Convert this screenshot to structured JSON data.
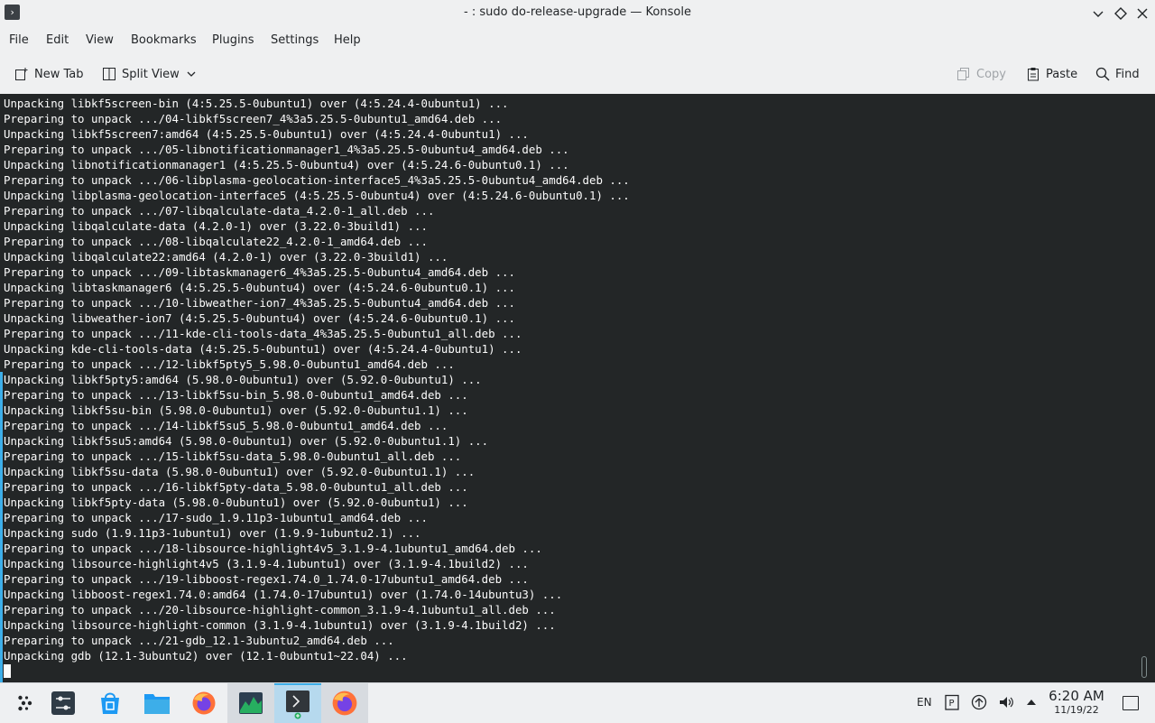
{
  "window": {
    "title": "- : sudo do-release-upgrade — Konsole"
  },
  "menu": [
    "File",
    "Edit",
    "View",
    "Bookmarks",
    "Plugins",
    "Settings",
    "Help"
  ],
  "toolbar": {
    "new_tab": "New Tab",
    "split_view": "Split View",
    "copy": "Copy",
    "paste": "Paste",
    "find": "Find"
  },
  "terminal": {
    "lines": [
      "Unpacking libkf5screen-bin (4:5.25.5-0ubuntu1) over (4:5.24.4-0ubuntu1) ...",
      "Preparing to unpack .../04-libkf5screen7_4%3a5.25.5-0ubuntu1_amd64.deb ...",
      "Unpacking libkf5screen7:amd64 (4:5.25.5-0ubuntu1) over (4:5.24.4-0ubuntu1) ...",
      "Preparing to unpack .../05-libnotificationmanager1_4%3a5.25.5-0ubuntu4_amd64.deb ...",
      "Unpacking libnotificationmanager1 (4:5.25.5-0ubuntu4) over (4:5.24.6-0ubuntu0.1) ...",
      "Preparing to unpack .../06-libplasma-geolocation-interface5_4%3a5.25.5-0ubuntu4_amd64.deb ...",
      "Unpacking libplasma-geolocation-interface5 (4:5.25.5-0ubuntu4) over (4:5.24.6-0ubuntu0.1) ...",
      "Preparing to unpack .../07-libqalculate-data_4.2.0-1_all.deb ...",
      "Unpacking libqalculate-data (4.2.0-1) over (3.22.0-3build1) ...",
      "Preparing to unpack .../08-libqalculate22_4.2.0-1_amd64.deb ...",
      "Unpacking libqalculate22:amd64 (4.2.0-1) over (3.22.0-3build1) ...",
      "Preparing to unpack .../09-libtaskmanager6_4%3a5.25.5-0ubuntu4_amd64.deb ...",
      "Unpacking libtaskmanager6 (4:5.25.5-0ubuntu4) over (4:5.24.6-0ubuntu0.1) ...",
      "Preparing to unpack .../10-libweather-ion7_4%3a5.25.5-0ubuntu4_amd64.deb ...",
      "Unpacking libweather-ion7 (4:5.25.5-0ubuntu4) over (4:5.24.6-0ubuntu0.1) ...",
      "Preparing to unpack .../11-kde-cli-tools-data_4%3a5.25.5-0ubuntu1_all.deb ...",
      "Unpacking kde-cli-tools-data (4:5.25.5-0ubuntu1) over (4:5.24.4-0ubuntu1) ...",
      "Preparing to unpack .../12-libkf5pty5_5.98.0-0ubuntu1_amd64.deb ...",
      "Unpacking libkf5pty5:amd64 (5.98.0-0ubuntu1) over (5.92.0-0ubuntu1) ...",
      "Preparing to unpack .../13-libkf5su-bin_5.98.0-0ubuntu1_amd64.deb ...",
      "Unpacking libkf5su-bin (5.98.0-0ubuntu1) over (5.92.0-0ubuntu1.1) ...",
      "Preparing to unpack .../14-libkf5su5_5.98.0-0ubuntu1_amd64.deb ...",
      "Unpacking libkf5su5:amd64 (5.98.0-0ubuntu1) over (5.92.0-0ubuntu1.1) ...",
      "Preparing to unpack .../15-libkf5su-data_5.98.0-0ubuntu1_all.deb ...",
      "Unpacking libkf5su-data (5.98.0-0ubuntu1) over (5.92.0-0ubuntu1.1) ...",
      "Preparing to unpack .../16-libkf5pty-data_5.98.0-0ubuntu1_all.deb ...",
      "Unpacking libkf5pty-data (5.98.0-0ubuntu1) over (5.92.0-0ubuntu1) ...",
      "Preparing to unpack .../17-sudo_1.9.11p3-1ubuntu1_amd64.deb ...",
      "Unpacking sudo (1.9.11p3-1ubuntu1) over (1.9.9-1ubuntu2.1) ...",
      "Preparing to unpack .../18-libsource-highlight4v5_3.1.9-4.1ubuntu1_amd64.deb ...",
      "Unpacking libsource-highlight4v5 (3.1.9-4.1ubuntu1) over (3.1.9-4.1build2) ...",
      "Preparing to unpack .../19-libboost-regex1.74.0_1.74.0-17ubuntu1_amd64.deb ...",
      "Unpacking libboost-regex1.74.0:amd64 (1.74.0-17ubuntu1) over (1.74.0-14ubuntu3) ...",
      "Preparing to unpack .../20-libsource-highlight-common_3.1.9-4.1ubuntu1_all.deb ...",
      "Unpacking libsource-highlight-common (3.1.9-4.1ubuntu1) over (3.1.9-4.1build2) ...",
      "Preparing to unpack .../21-gdb_12.1-3ubuntu2_amd64.deb ...",
      "Unpacking gdb (12.1-3ubuntu2) over (12.1-0ubuntu1~22.04) ..."
    ]
  },
  "taskbar": {
    "tasks": [
      {
        "icon": "app-launcher-icon"
      },
      {
        "icon": "system-settings-icon"
      },
      {
        "icon": "discover-icon"
      },
      {
        "icon": "file-manager-icon"
      },
      {
        "icon": "firefox-icon"
      },
      {
        "icon": "system-monitor-icon"
      },
      {
        "icon": "konsole-icon"
      },
      {
        "icon": "firefox-window-icon"
      }
    ],
    "tray": {
      "language": "EN",
      "time": "6:20 AM",
      "date": "11/19/22"
    }
  }
}
